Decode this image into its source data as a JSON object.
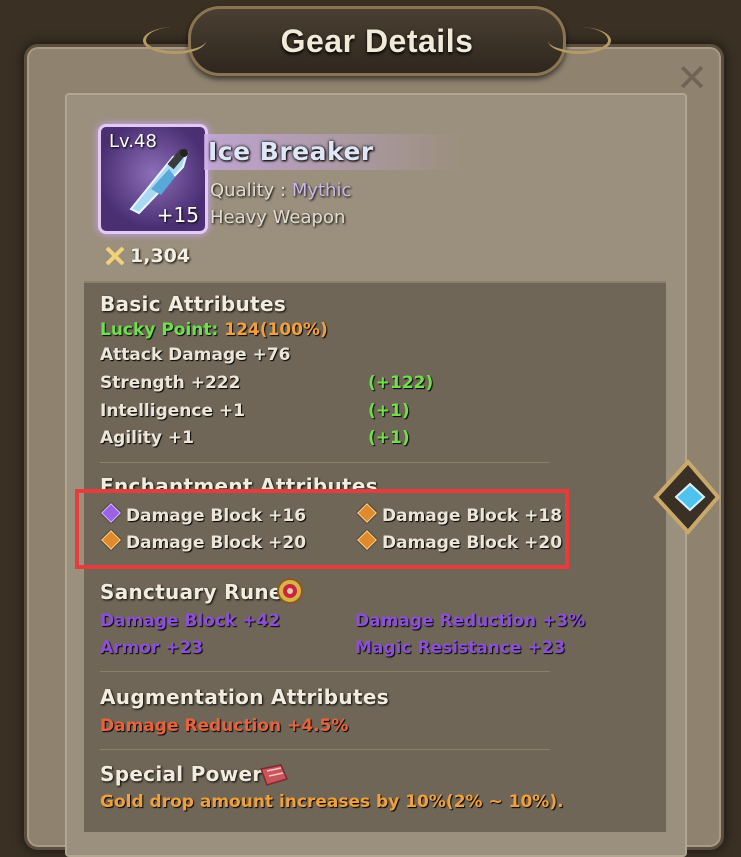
{
  "header": {
    "title": "Gear Details"
  },
  "item": {
    "level": "Lv.48",
    "enhance": "+15",
    "name": "Ice Breaker",
    "quality_label": "Quality : ",
    "quality_value": "Mythic",
    "type": "Heavy Weapon",
    "power": "1,304"
  },
  "basic": {
    "title": "Basic Attributes",
    "lucky_label": "Lucky Point: ",
    "lucky_value": "124(100%)",
    "rows": [
      {
        "label": "Attack Damage +76",
        "bonus": ""
      },
      {
        "label": "Strength +222",
        "bonus": "(+122)"
      },
      {
        "label": "Intelligence +1",
        "bonus": "(+1)"
      },
      {
        "label": "Agility +1",
        "bonus": "(+1)"
      }
    ]
  },
  "enchant": {
    "title": "Enchantment Attributes",
    "items": [
      {
        "text": "Damage Block +16",
        "gem": "purple"
      },
      {
        "text": "Damage Block +18",
        "gem": "orange"
      },
      {
        "text": "Damage Block +20",
        "gem": "orange"
      },
      {
        "text": "Damage Block +20",
        "gem": "orange"
      }
    ]
  },
  "rune": {
    "title": "Sanctuary Rune",
    "items": [
      "Damage Block +42",
      "Damage Reduction +3%",
      "Armor +23",
      "Magic Resistance +23"
    ]
  },
  "augment": {
    "title": "Augmentation Attributes",
    "text": "Damage Reduction +4.5%"
  },
  "special": {
    "title": "Special Power",
    "text": "Gold drop amount increases by 10%(2% ~ 10%)."
  },
  "colors": {
    "highlight": "#e83c3c",
    "green": "#6ee04a",
    "orange": "#f2a03b",
    "purple": "#8b4fd8"
  },
  "icons": {
    "close": "close-icon",
    "power": "crossed-swords-icon",
    "rune": "rune-icon",
    "special": "book-icon",
    "next": "arrow-right-icon"
  }
}
